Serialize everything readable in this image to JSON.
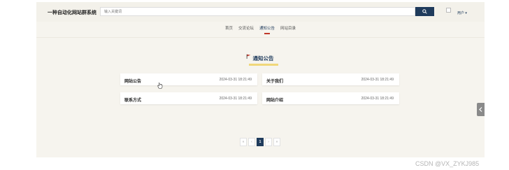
{
  "header": {
    "site_title": "一种自动化网站群系统",
    "search_placeholder": "输入关键词",
    "user_label": "用户 ▾",
    "search_icon": "search-icon"
  },
  "nav": {
    "items": [
      {
        "label": "首页"
      },
      {
        "label": "交流论坛"
      },
      {
        "label": "通知公告"
      },
      {
        "label": "网站目录"
      }
    ],
    "active_index": 2
  },
  "section": {
    "title": "通知公告",
    "flag_icon": "flag-icon",
    "accent_color": "#c0392b"
  },
  "cards": [
    {
      "title": "网站公告",
      "date": "2024-03-31 18:21:49"
    },
    {
      "title": "关于我们",
      "date": "2024-03-31 18:21:49"
    },
    {
      "title": "联系方式",
      "date": "2024-03-31 18:21:49"
    },
    {
      "title": "网站介绍",
      "date": "2024-03-31 18:21:49"
    }
  ],
  "pagination": {
    "first": "«",
    "prev": "‹",
    "current": "1",
    "next": "›",
    "last": "»"
  },
  "watermark": "CSDN @VX_ZYKJ985",
  "colors": {
    "brand_dark": "#1f3b5c",
    "page_bg": "#f6f4ee",
    "highlight": "#f0d77a"
  }
}
